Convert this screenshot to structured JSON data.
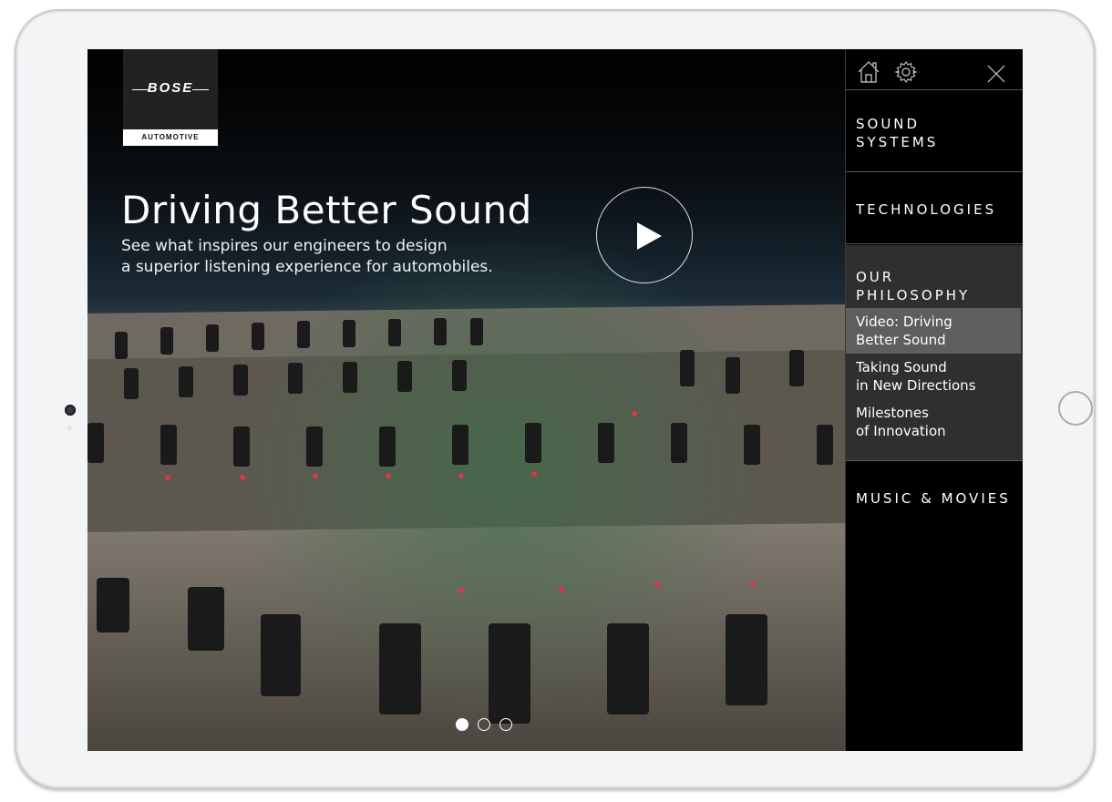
{
  "brand": {
    "logo_text": "BOSE",
    "logo_sub": "AUTOMOTIVE"
  },
  "hero": {
    "title": "Driving Better Sound",
    "subtitle_line1": "See what inspires our engineers to design",
    "subtitle_line2": "a superior listening experience for automobiles.",
    "play_icon": "play-icon"
  },
  "pagination": {
    "total": 3,
    "current": 1
  },
  "nav": {
    "icons": [
      "home-icon",
      "gear-icon",
      "close-icon"
    ],
    "sections": [
      {
        "line1": "SOUND",
        "line2": "SYSTEMS"
      },
      {
        "line1": "TECHNOLOGIES"
      },
      {
        "line1": "OUR",
        "line2": "PHILOSOPHY",
        "items": [
          {
            "line1": "Video: Driving",
            "line2": "Better Sound",
            "active": true
          },
          {
            "line1": "Taking Sound",
            "line2": "in New Directions"
          },
          {
            "line1": "Milestones",
            "line2": "of Innovation"
          }
        ]
      },
      {
        "line1": "MUSIC & MOVIES"
      }
    ]
  },
  "colors": {
    "nav_bg": "#000000",
    "nav_expanded_bg": "#2f2f2f",
    "nav_active_bg": "#5e5e5e",
    "text": "#ffffff"
  }
}
